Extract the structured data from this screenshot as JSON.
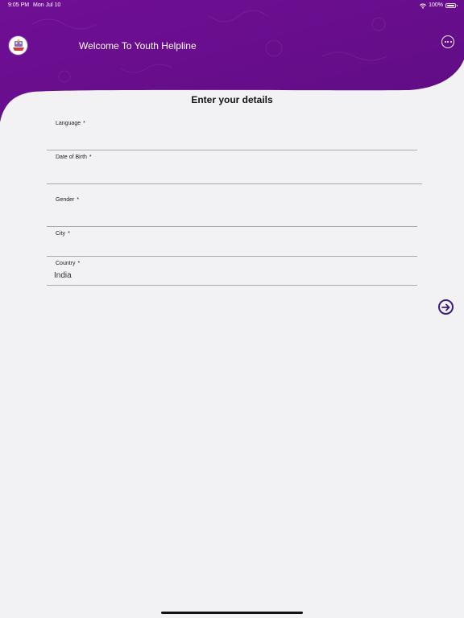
{
  "status_bar": {
    "time": "9:05 PM",
    "date": "Mon Jul 10",
    "battery_percent": "100%"
  },
  "header": {
    "title": "Welcome To Youth Helpline",
    "logo_icon": "youth-helpline-logo",
    "more_icon": "ellipsis-circle-icon"
  },
  "form": {
    "heading": "Enter your details",
    "fields": [
      {
        "label": "Language",
        "required_mark": "*",
        "value": ""
      },
      {
        "label": "Date of Birth",
        "required_mark": "*",
        "value": ""
      },
      {
        "label": "Gender",
        "required_mark": "*",
        "value": ""
      },
      {
        "label": "City",
        "required_mark": "*",
        "value": ""
      },
      {
        "label": "Country",
        "required_mark": "*",
        "value": "India"
      }
    ],
    "next_icon": "arrow-right-circle-icon"
  },
  "colors": {
    "header_purple": "#6b0f8f",
    "background": "#f2f2f4",
    "accent": "#3d1b7a"
  }
}
